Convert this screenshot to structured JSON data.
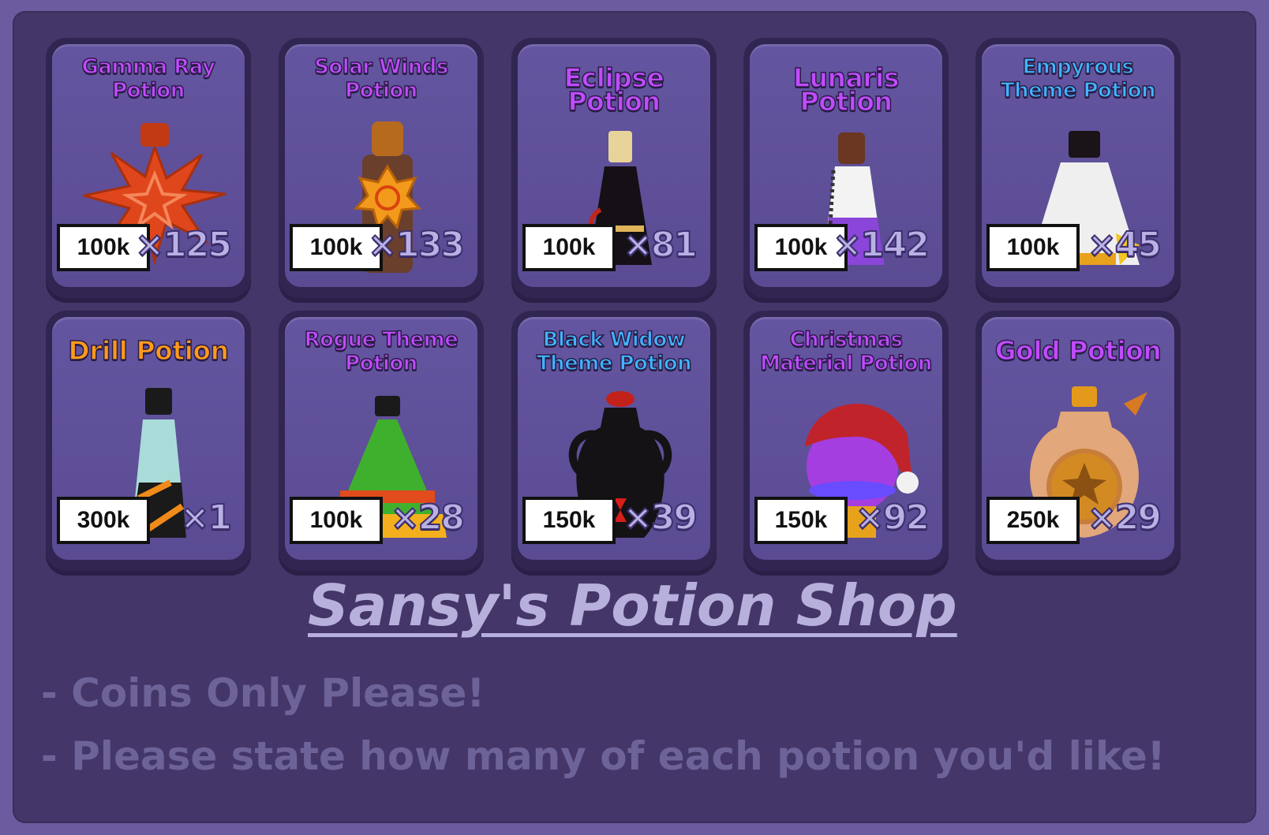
{
  "shop": {
    "title": "Sansy's Potion Shop",
    "notes": [
      "- Coins Only Please!",
      "- Please state how many of each potion you'd like!"
    ]
  },
  "potions": [
    {
      "name": "Gamma Ray Potion",
      "price": "100k",
      "qty": "×125",
      "title_color": "#c24bff",
      "icon": "gamma-ray-potion-icon"
    },
    {
      "name": "Solar Winds Potion",
      "price": "100k",
      "qty": "×133",
      "title_color": "#c24bff",
      "icon": "solar-winds-potion-icon"
    },
    {
      "name": "Eclipse Potion",
      "price": "100k",
      "qty": "×81",
      "title_color": "#c24bff",
      "icon": "eclipse-potion-icon"
    },
    {
      "name": "Lunaris Potion",
      "price": "100k",
      "qty": "×142",
      "title_color": "#c24bff",
      "icon": "lunaris-potion-icon"
    },
    {
      "name": "Empyrous Theme Potion",
      "price": "100k",
      "qty": "×45",
      "title_color": "#3fb6ff",
      "icon": "empyrous-theme-potion-icon"
    },
    {
      "name": "Drill Potion",
      "price": "300k",
      "qty": "×1",
      "title_color": "#ff9a1a",
      "icon": "drill-potion-icon"
    },
    {
      "name": "Rogue Theme Potion",
      "price": "100k",
      "qty": "×28",
      "title_color": "#c24bff",
      "icon": "rogue-theme-potion-icon"
    },
    {
      "name": "Black Widow Theme Potion",
      "price": "150k",
      "qty": "×39",
      "title_color": "#3fb6ff",
      "icon": "black-widow-theme-potion-icon"
    },
    {
      "name": "Christmas Material Potion",
      "price": "150k",
      "qty": "×92",
      "title_color": "#c24bff",
      "icon": "christmas-material-potion-icon"
    },
    {
      "name": "Gold Potion",
      "price": "250k",
      "qty": "×29",
      "title_color": "#c24bff",
      "icon": "gold-potion-icon"
    }
  ]
}
